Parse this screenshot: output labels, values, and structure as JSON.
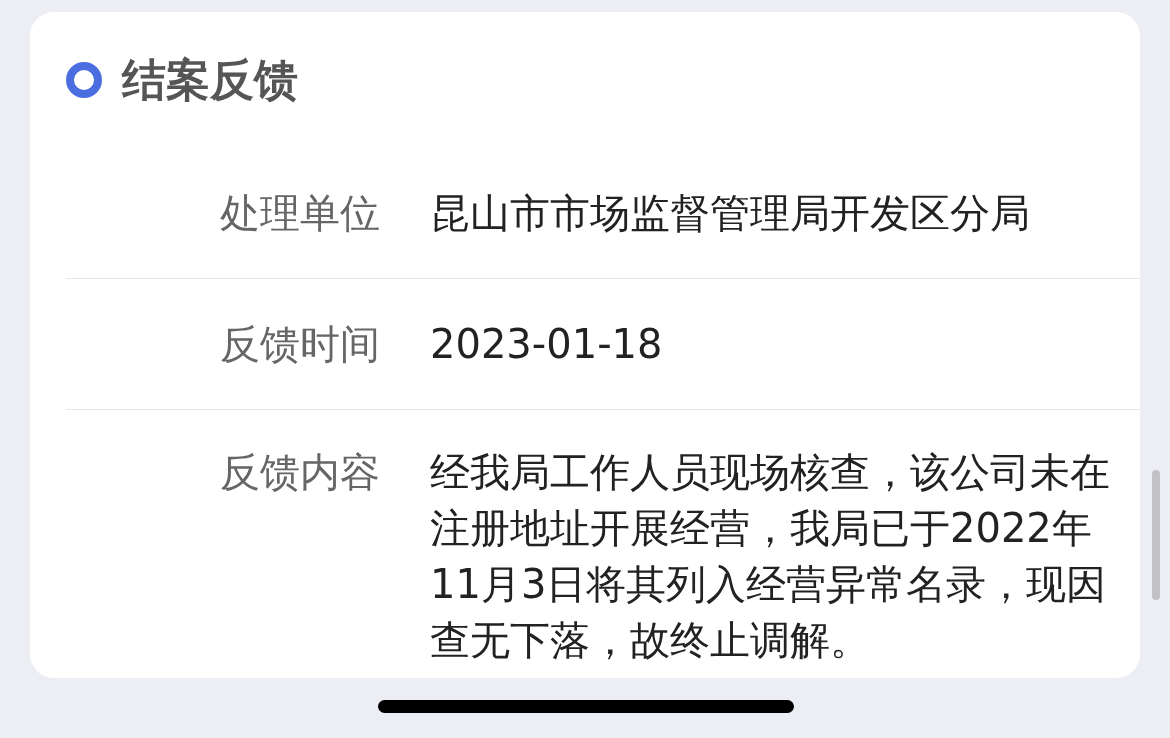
{
  "section": {
    "title": "结案反馈"
  },
  "fields": [
    {
      "label": "处理单位",
      "value": "昆山市市场监督管理局开发区分局"
    },
    {
      "label": "反馈时间",
      "value": "2023-01-18"
    },
    {
      "label": "反馈内容",
      "value": "经我局工作人员现场核查，该公司未在注册地址开展经营，我局已于2022年11月3日将其列入经营异常名录，现因查无下落，故终止调解。"
    }
  ]
}
